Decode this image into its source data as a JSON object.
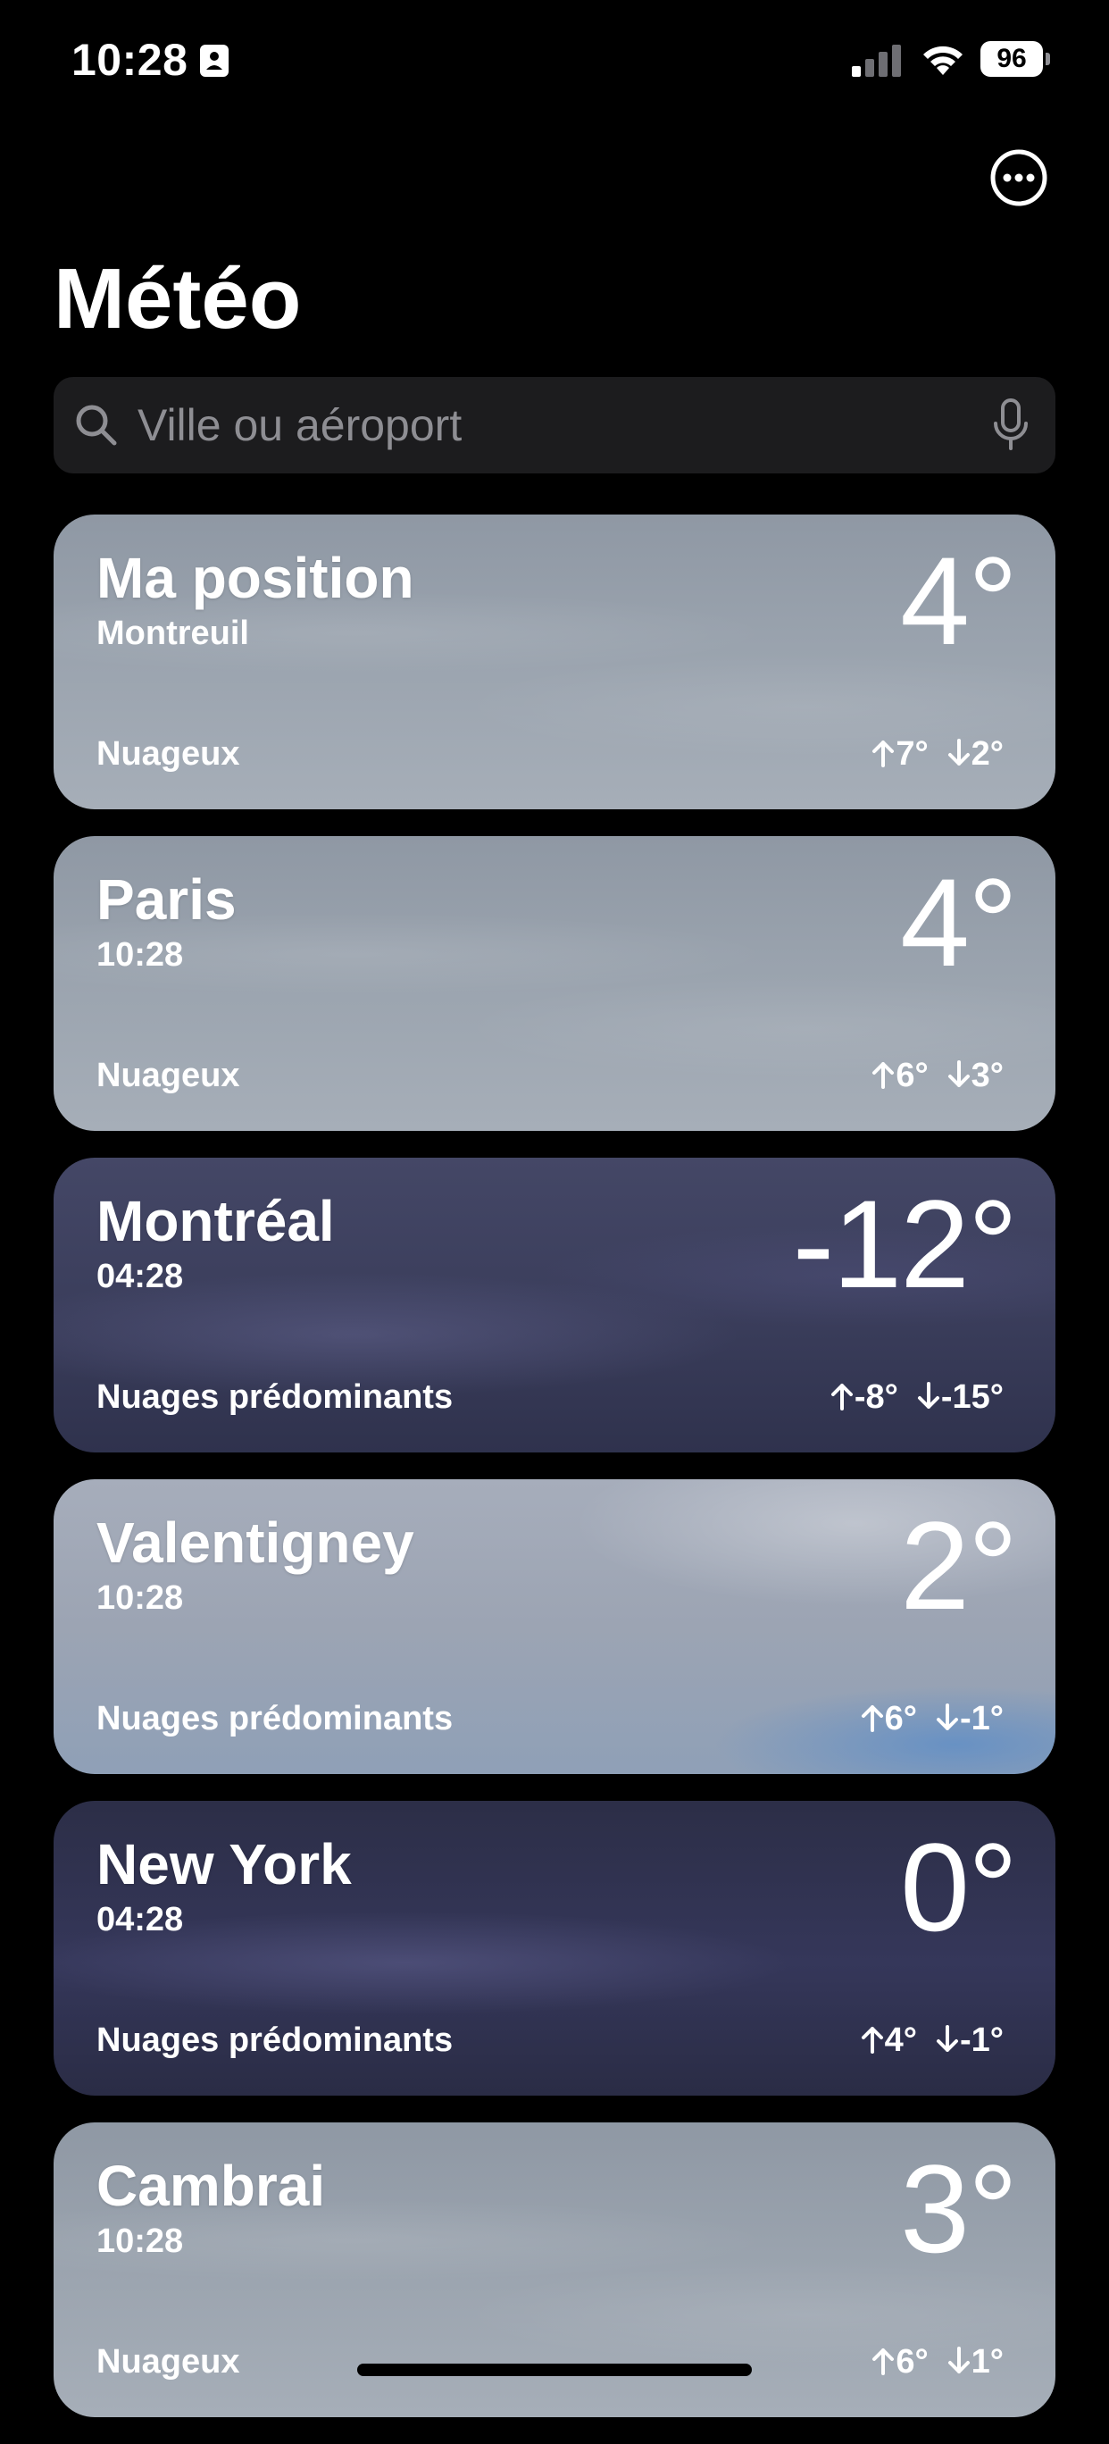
{
  "status_bar": {
    "time": "10:28",
    "battery": "96"
  },
  "title": "Météo",
  "search": {
    "placeholder": "Ville ou aéroport"
  },
  "cards": [
    {
      "city": "Ma position",
      "subtitle": "Montreuil",
      "temperature": "4°",
      "condition": "Nuageux",
      "high": "7°",
      "low": "2°",
      "theme": "gray"
    },
    {
      "city": "Paris",
      "subtitle": "10:28",
      "temperature": "4°",
      "condition": "Nuageux",
      "high": "6°",
      "low": "3°",
      "theme": "gray"
    },
    {
      "city": "Montréal",
      "subtitle": "04:28",
      "temperature": "-12°",
      "condition": "Nuages prédominants",
      "high": "-8°",
      "low": "-15°",
      "theme": "dark"
    },
    {
      "city": "Valentigney",
      "subtitle": "10:28",
      "temperature": "2°",
      "condition": "Nuages prédominants",
      "high": "6°",
      "low": "-1°",
      "theme": "light"
    },
    {
      "city": "New York",
      "subtitle": "04:28",
      "temperature": "0°",
      "condition": "Nuages prédominants",
      "high": "4°",
      "low": "-1°",
      "theme": "navy"
    },
    {
      "city": "Cambrai",
      "subtitle": "10:28",
      "temperature": "3°",
      "condition": "Nuageux",
      "high": "6°",
      "low": "1°",
      "theme": "gray"
    }
  ],
  "colors": {
    "background": "#000000",
    "search_background": "#1c1c1e",
    "placeholder": "#8e8e93"
  },
  "icons": {
    "more": "ellipsis-circle-icon",
    "search": "magnifying-glass-icon",
    "mic": "microphone-icon"
  }
}
